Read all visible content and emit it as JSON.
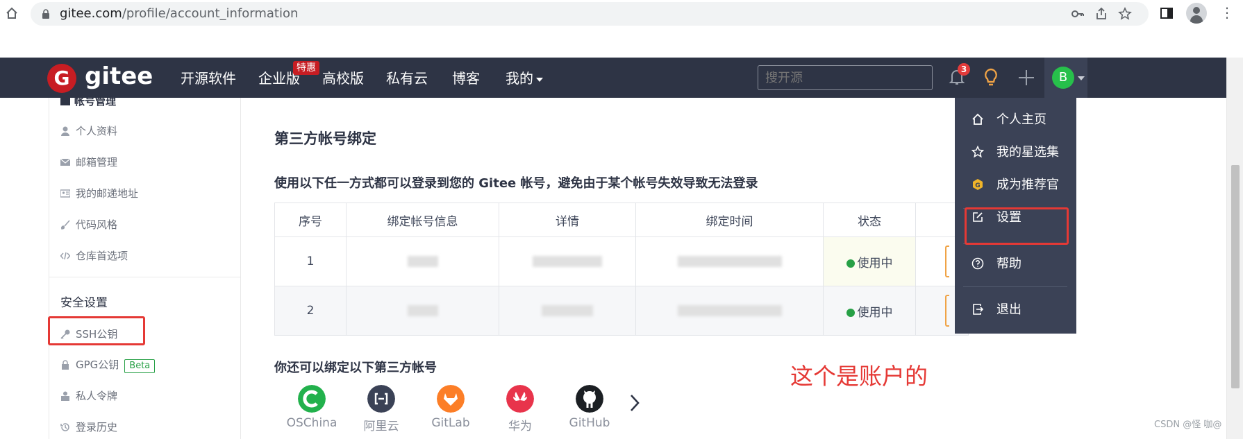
{
  "browser": {
    "url_domain": "gitee.com",
    "url_path": "/profile/account_information"
  },
  "nav": {
    "logo_text": "gitee",
    "logo_mark": "G",
    "items": [
      "开源软件",
      "企业版",
      "高校版",
      "私有云",
      "博客",
      "我的"
    ],
    "hot_badge": "特惠",
    "search_placeholder": "搜开源",
    "notification_count": "3",
    "avatar_letter": "B"
  },
  "sidebar": {
    "account_head": "帐号管理",
    "account_items": [
      "个人资料",
      "邮箱管理",
      "我的邮递地址",
      "代码风格",
      "仓库首选项"
    ],
    "security_head": "安全设置",
    "security_items": [
      "SSH公钥",
      "GPG公钥",
      "私人令牌",
      "登录历史"
    ],
    "beta_label": "Beta"
  },
  "main": {
    "title": "第三方帐号绑定",
    "description": "使用以下任一方式都可以登录到您的 Gitee 帐号，避免由于某个帐号失效导致无法登录",
    "table": {
      "headers": [
        "序号",
        "绑定帐号信息",
        "详情",
        "绑定时间",
        "状态"
      ],
      "rows": [
        {
          "index": "1",
          "status": "使用中"
        },
        {
          "index": "2",
          "status": "使用中"
        }
      ]
    },
    "also_title": "你还可以绑定以下第三方帐号",
    "providers": [
      "OSChina",
      "阿里云",
      "GitLab",
      "华为",
      "GitHub"
    ]
  },
  "dropdown": {
    "items": [
      "个人主页",
      "我的星选集",
      "成为推荐官",
      "设置",
      "帮助",
      "退出"
    ]
  },
  "annotation": "这个是账户的",
  "watermark": "CSDN @怪 咖@",
  "colors": {
    "navbar": "#2e3445",
    "brand_red": "#c71d23",
    "status_green": "#27a046",
    "highlight_red": "#e53935"
  }
}
